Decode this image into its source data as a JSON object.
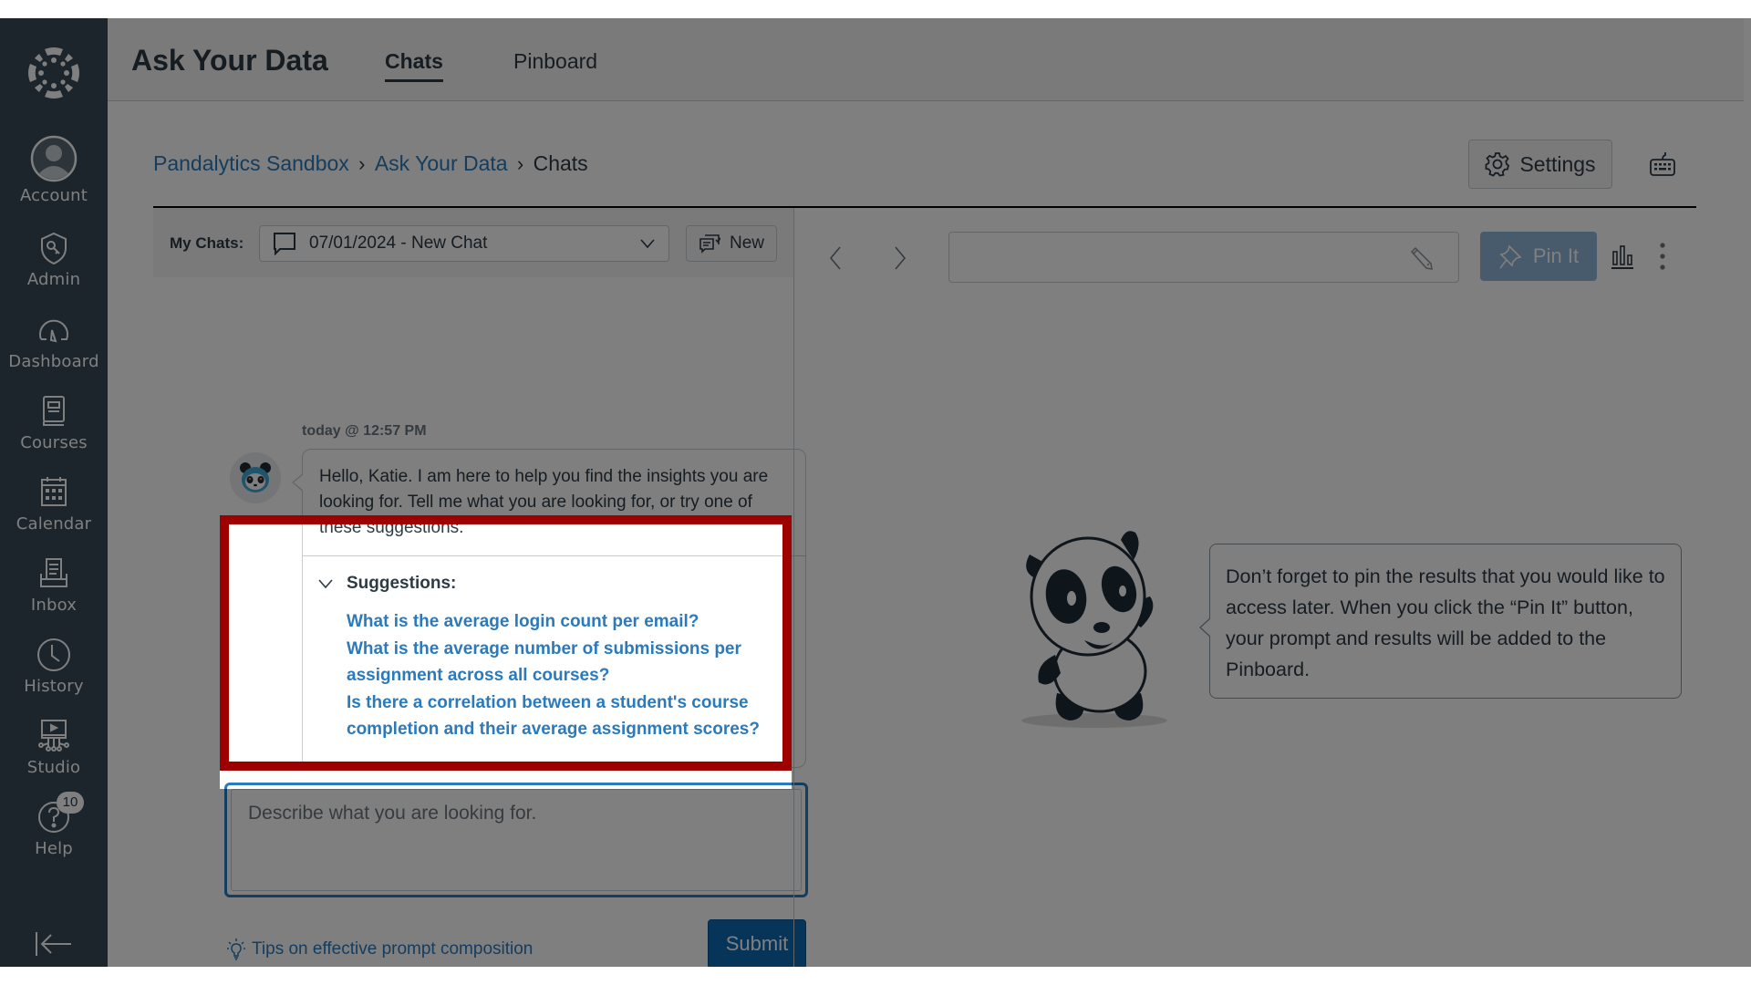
{
  "sidebar": {
    "items": [
      {
        "label": "Account",
        "icon": "account-avatar-icon"
      },
      {
        "label": "Admin",
        "icon": "shield-key-icon"
      },
      {
        "label": "Dashboard",
        "icon": "speedometer-icon"
      },
      {
        "label": "Courses",
        "icon": "book-icon"
      },
      {
        "label": "Calendar",
        "icon": "calendar-icon"
      },
      {
        "label": "Inbox",
        "icon": "inbox-icon"
      },
      {
        "label": "History",
        "icon": "clock-icon"
      },
      {
        "label": "Studio",
        "icon": "studio-icon"
      },
      {
        "label": "Help",
        "icon": "help-icon",
        "badge": "10"
      }
    ],
    "collapse_icon": "collapse-left-icon"
  },
  "header": {
    "title": "Ask Your Data",
    "tabs": [
      {
        "label": "Chats",
        "active": true
      },
      {
        "label": "Pinboard",
        "active": false
      }
    ]
  },
  "breadcrumb": {
    "items": [
      "Pandalytics Sandbox",
      "Ask Your Data",
      "Chats"
    ]
  },
  "toolbar": {
    "settings_label": "Settings"
  },
  "chats": {
    "my_chats_label": "My Chats:",
    "selected_chat": "07/01/2024 - New Chat",
    "new_label": "New"
  },
  "conversation": {
    "timestamp": "today @ 12:57 PM",
    "message": "Hello, Katie. I am here to help you find the insights you are looking for. Tell me what you are looking for, or try one of these suggestions.",
    "suggestions_label": "Suggestions:",
    "suggestions": [
      "What is the average login count per email?",
      "What is the average number of submissions per assignment across all courses?",
      "Is there a correlation between a student's course completion and their average assignment scores?"
    ]
  },
  "prompt": {
    "placeholder": "Describe what you are looking for.",
    "value": "",
    "tips_label": "Tips on effective prompt composition",
    "submit_label": "Submit"
  },
  "results": {
    "title_value": "",
    "pin_label": "Pin It",
    "tip_text": "Don’t forget to pin the results that you would like to access later. When you click the “Pin It” button, your prompt and results will be added to the Pinboard."
  },
  "colors": {
    "sidebar_bg": "#394B58",
    "link": "#2B7ABC",
    "primary_button": "#0E68B3",
    "highlight_border": "#9E0000",
    "overlay": "rgba(0,0,0,0.5)"
  }
}
